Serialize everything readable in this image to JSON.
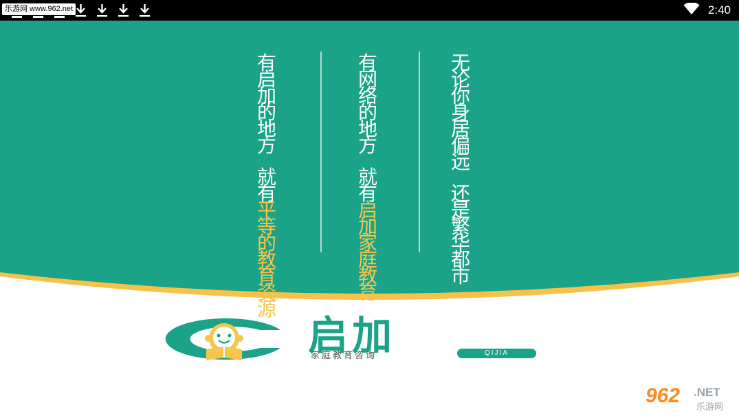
{
  "status_bar": {
    "watermark_tag": "乐游网 www.962.net",
    "time": "2:40",
    "notification_icons": [
      "dash-icon",
      "dash-icon",
      "dash-icon",
      "download-icon",
      "download-icon",
      "download-icon",
      "download-icon"
    ],
    "wifi_icon": "wifi-icon"
  },
  "splash": {
    "bg_color": "#1aa388",
    "highlight_color": "#f6c54b",
    "columns": [
      {
        "first": "有启加的地方",
        "second_plain": "就有",
        "second_highlight": "平等的教育资源"
      },
      {
        "first": "有网络的地方",
        "second_plain": "就有",
        "second_highlight": "启加家庭教育"
      },
      {
        "first": "无论你身居偏远",
        "second_plain": "还是繁华都市",
        "second_highlight": ""
      }
    ]
  },
  "logo": {
    "name": "启加",
    "subtitle": "家庭教育咨询",
    "pill": "QIJIA",
    "accent": "#1aa388"
  },
  "site_watermark": {
    "number": "962",
    "suffix": ".NET",
    "cn": "乐游网"
  }
}
